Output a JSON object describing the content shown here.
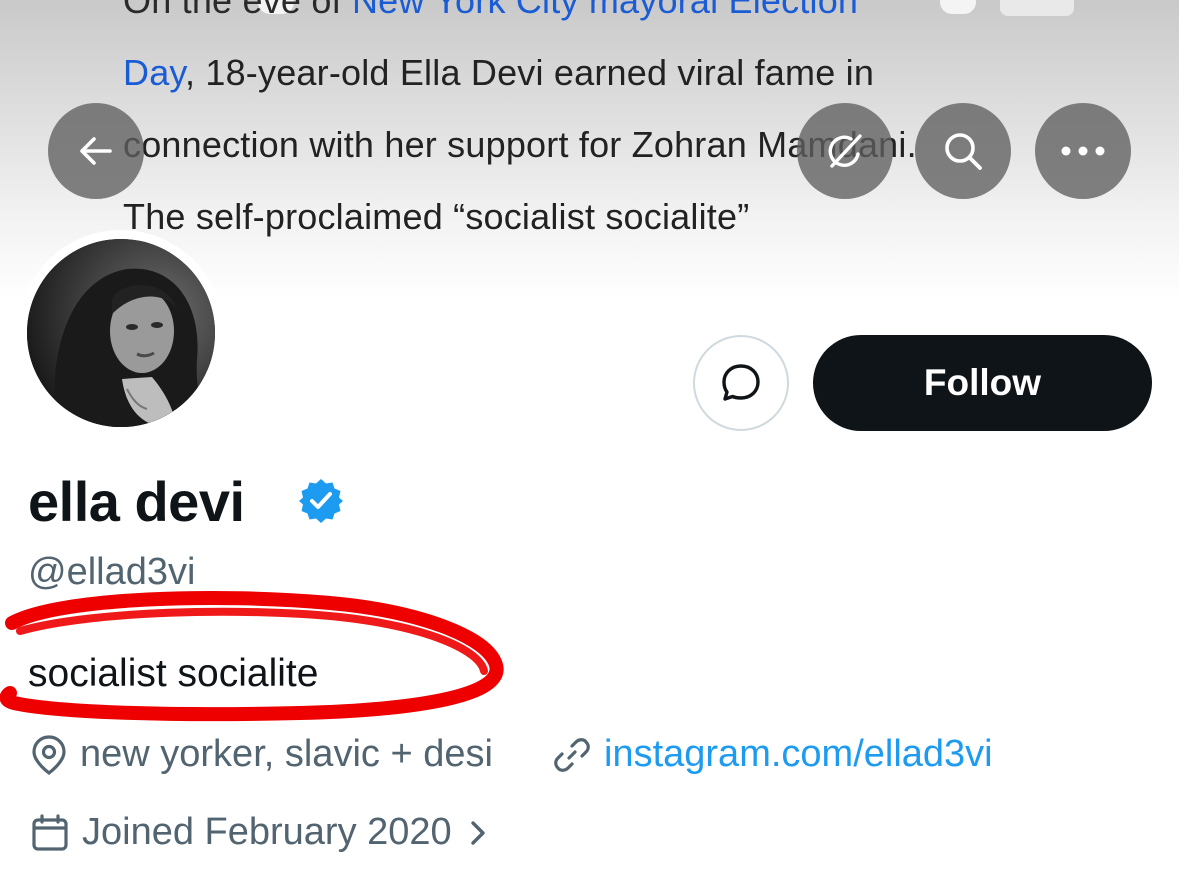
{
  "banner": {
    "lines": [
      {
        "pre": "On the eve of ",
        "link": "New York City mayoral Election",
        "post": ""
      },
      {
        "pre": "",
        "link": "Day",
        "post": ", 18-year-old Ella Devi earned viral fame in"
      },
      {
        "pre": "connection with her support for Zohran Mamdani.",
        "link": "",
        "post": ""
      },
      {
        "pre": "The self-proclaimed “socialist socialite”",
        "link": "",
        "post": ""
      }
    ]
  },
  "overlay_icons": {
    "back": "arrow-left-icon",
    "ai": "grok-icon",
    "search": "search-icon",
    "more": "more-icon"
  },
  "actions": {
    "follow_label": "Follow",
    "message_icon": "message-icon"
  },
  "profile": {
    "display_name": "ella devi",
    "handle": "@ellad3vi",
    "bio": "socialist socialite",
    "location": "new yorker, slavic + desi",
    "website": "instagram.com/ellad3vi",
    "joined": "Joined February 2020"
  },
  "colors": {
    "link_blue": "#1d9bf0",
    "verified_blue": "#1d9bf0",
    "follow_bg": "#0f1419",
    "secondary_text": "#536471",
    "highlight_red": "#ee0000"
  }
}
